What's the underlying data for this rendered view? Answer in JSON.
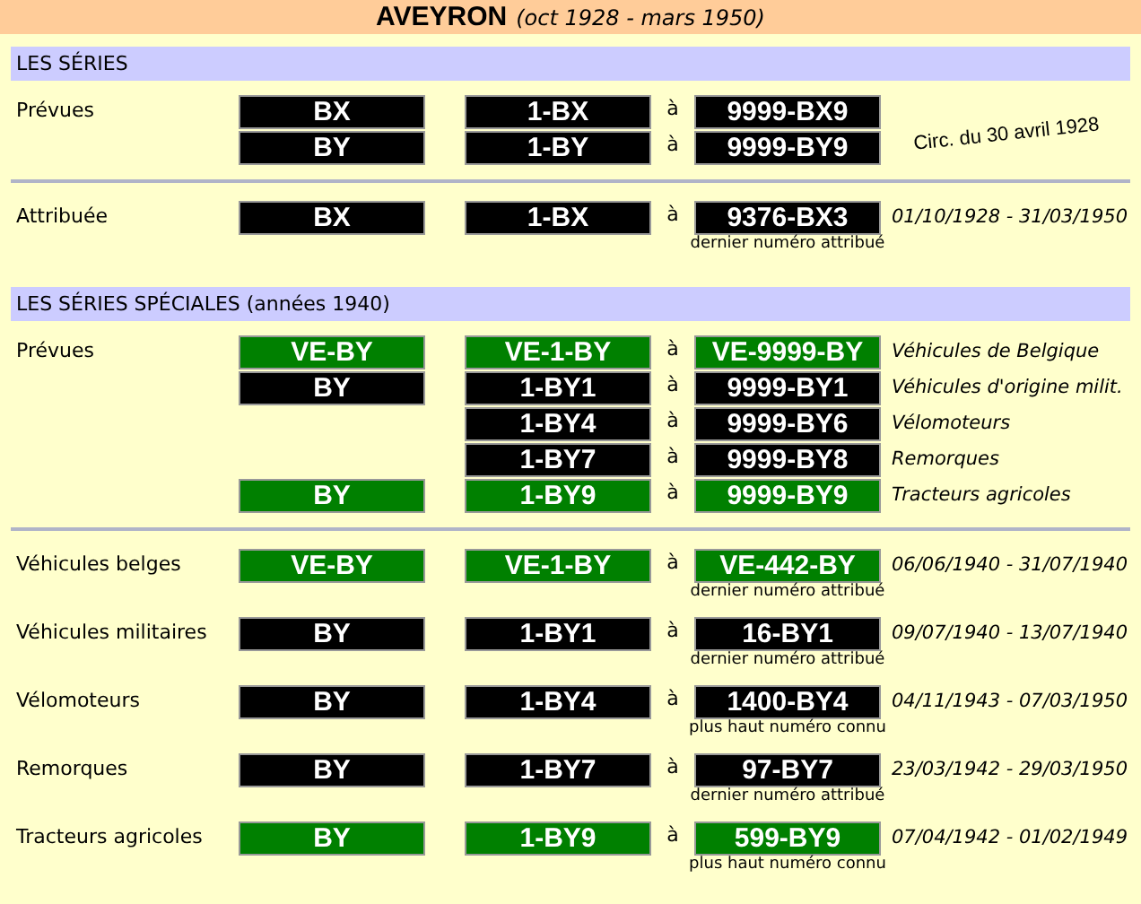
{
  "title": {
    "name": "AVEYRON",
    "period": "(oct 1928 - mars 1950)"
  },
  "sections": [
    {
      "heading": "LES SÉRIES",
      "groups": [
        {
          "label": "Prévues",
          "side_note": "Circ. du 30 avril 1928",
          "rows": [
            {
              "series": "BX",
              "from": "1-BX",
              "sep": "à",
              "to": "9999-BX9",
              "color": "#000000"
            },
            {
              "series": "BY",
              "from": "1-BY",
              "sep": "à",
              "to": "9999-BY9",
              "color": "#000000"
            }
          ]
        },
        {
          "label": "Attribuée",
          "rows": [
            {
              "series": "BX",
              "from": "1-BX",
              "sep": "à",
              "to": "9376-BX3",
              "color": "#000000",
              "note": "01/10/1928 - 31/03/1950",
              "sub": "dernier numéro attribué"
            }
          ]
        }
      ]
    },
    {
      "heading": "LES SÉRIES SPÉCIALES (années 1940)",
      "groups": [
        {
          "label": "Prévues",
          "rows": [
            {
              "series": "VE-BY",
              "from": "VE-1-BY",
              "sep": "à",
              "to": "VE-9999-BY",
              "color": "#008000",
              "note": "Véhicules de Belgique"
            },
            {
              "series": "BY",
              "from": "1-BY1",
              "sep": "à",
              "to": "9999-BY1",
              "color": "#000000",
              "note": "Véhicules d'origine milit."
            },
            {
              "from": "1-BY4",
              "sep": "à",
              "to": "9999-BY6",
              "color": "#000000",
              "note": "Vélomoteurs"
            },
            {
              "from": "1-BY7",
              "sep": "à",
              "to": "9999-BY8",
              "color": "#000000",
              "note": "Remorques"
            },
            {
              "series": "BY",
              "from": "1-BY9",
              "sep": "à",
              "to": "9999-BY9",
              "color": "#008000",
              "note": "Tracteurs agricoles"
            }
          ]
        },
        {
          "label": "Véhicules belges",
          "rows": [
            {
              "series": "VE-BY",
              "from": "VE-1-BY",
              "sep": "à",
              "to": "VE-442-BY",
              "color": "#008000",
              "note": "06/06/1940 - 31/07/1940",
              "sub": "dernier numéro attribué"
            }
          ]
        },
        {
          "label": "Véhicules militaires",
          "rows": [
            {
              "series": "BY",
              "from": "1-BY1",
              "sep": "à",
              "to": "16-BY1",
              "color": "#000000",
              "note": "09/07/1940 - 13/07/1940",
              "sub": "dernier numéro attribué"
            }
          ]
        },
        {
          "label": "Vélomoteurs",
          "rows": [
            {
              "series": "BY",
              "from": "1-BY4",
              "sep": "à",
              "to": "1400-BY4",
              "color": "#000000",
              "note": "04/11/1943 - 07/03/1950",
              "sub": "plus haut numéro connu"
            }
          ]
        },
        {
          "label": "Remorques",
          "rows": [
            {
              "series": "BY",
              "from": "1-BY7",
              "sep": "à",
              "to": "97-BY7",
              "color": "#000000",
              "note": "23/03/1942 - 29/03/1950",
              "sub": "dernier numéro attribué"
            }
          ]
        },
        {
          "label": "Tracteurs agricoles",
          "rows": [
            {
              "series": "BY",
              "from": "1-BY9",
              "sep": "à",
              "to": "599-BY9",
              "color": "#008000",
              "note": "07/04/1942 - 01/02/1949",
              "sub": "plus haut numéro connu"
            }
          ]
        }
      ]
    }
  ]
}
